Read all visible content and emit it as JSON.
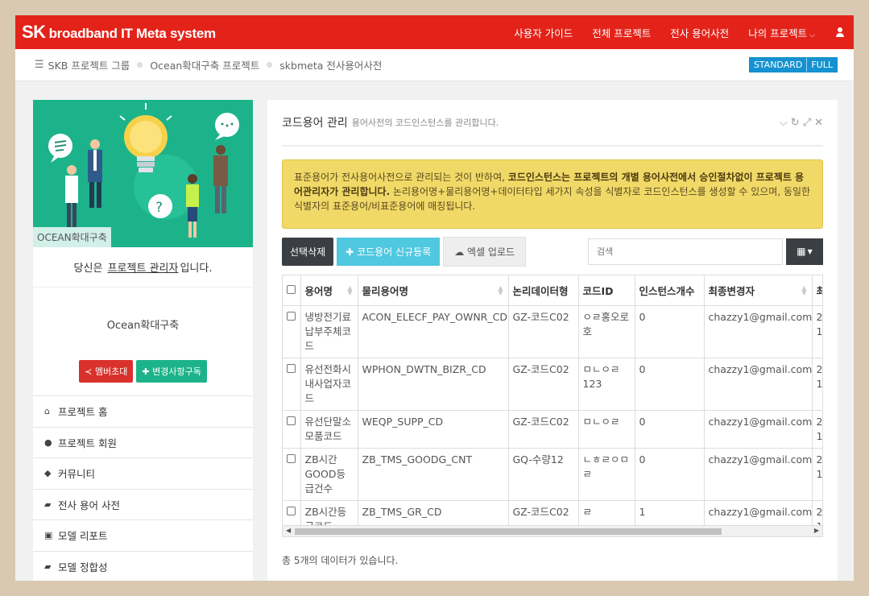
{
  "header": {
    "brand_sk": "SK",
    "brand_rest": "broadband IT Meta system",
    "nav": [
      "사용자 가이드",
      "전체 프로젝트",
      "전사 용어사전",
      "나의 프로젝트"
    ]
  },
  "breadcrumb": {
    "items": [
      "SKB 프로젝트 그룹",
      "Ocean확대구축 프로젝트",
      "skbmeta 전사용어사전"
    ],
    "modes": [
      "STANDARD",
      "FULL"
    ]
  },
  "sidebar": {
    "hero_label": "OCEAN확대구축",
    "role_prefix": "당신은",
    "role_link": "프로젝트 관리자",
    "role_suffix": "입니다.",
    "project_name": "Ocean확대구축",
    "invite_label": "멤버초대",
    "subscribe_label": "변경사항구독",
    "menu": [
      {
        "icon": "home-icon",
        "label": "프로젝트 홈"
      },
      {
        "icon": "users-icon",
        "label": "프로젝트 회원"
      },
      {
        "icon": "comments-icon",
        "label": "커뮤니티"
      },
      {
        "icon": "book-icon",
        "label": "전사 용어 사전"
      },
      {
        "icon": "archive-icon",
        "label": "모델 리포트"
      },
      {
        "icon": "book-icon",
        "label": "모델 정합성"
      }
    ]
  },
  "panel": {
    "title": "코드용어 관리",
    "subtitle": "용어사전의 코드인스턴스를 관리합니다.",
    "alert_1": "표준용어가 전사용어사전으로 관리되는 것이 반하여, ",
    "alert_bold": "코드인스턴스는 프로젝트의 개별 용어사전에서 승인절차없이 프로젝트 용어관리자가 관리합니다.",
    "alert_2": " 논리용어명+물리용어명+데이터타입 세가지 속성을 식별자로 코드인스턴스를 생성할 수 있으며, 동일한 식별자의 표준용어/비표준용어에 매칭됩니다.",
    "btn_delete": "선택삭제",
    "btn_new": "코드용어 신규등록",
    "btn_excel": "엑셀 업로드",
    "search_placeholder": "검색",
    "columns": [
      "용어명",
      "물리용어명",
      "논리데이터형",
      "코드ID",
      "인스턴스개수",
      "최종변경자",
      "최"
    ],
    "rows": [
      {
        "term": "냉방전기료납부주체코드",
        "physical": "ACON_ELECF_PAY_OWNR_CD",
        "logical": "GZ-코드C02",
        "code_id": "ㅇㄹ홍오로호",
        "count": "0",
        "editor": "chazzy1@gmail.com",
        "date": "2(\n1:"
      },
      {
        "term": "유선전화시내사업자코드",
        "physical": "WPHON_DWTN_BIZR_CD",
        "logical": "GZ-코드C02",
        "code_id": "ㅁㄴㅇㄹ123",
        "count": "0",
        "editor": "chazzy1@gmail.com",
        "date": "2(\n1:"
      },
      {
        "term": "유선단말소모품코드",
        "physical": "WEQP_SUPP_CD",
        "logical": "GZ-코드C02",
        "code_id": "ㅁㄴㅇㄹ",
        "count": "0",
        "editor": "chazzy1@gmail.com",
        "date": "2(\n1:"
      },
      {
        "term": "ZB시간GOOD등급건수",
        "physical": "ZB_TMS_GOODG_CNT",
        "logical": "GQ-수량12",
        "code_id": "ㄴㅎㄹㅇㅁㄹ",
        "count": "0",
        "editor": "chazzy1@gmail.com",
        "date": "2(\n1:"
      },
      {
        "term": "ZB시간등급코드",
        "physical": "ZB_TMS_GR_CD",
        "logical": "GZ-코드C02",
        "code_id": "ㄹ",
        "count": "1",
        "editor": "chazzy1@gmail.com",
        "date": "2(\n1("
      }
    ],
    "footer": "총 5개의 데이터가 있습니다."
  },
  "colors": {
    "brand_red": "#e3231a",
    "teal": "#1cb38a",
    "alert": "#f1d968",
    "cyan": "#4fc8e0"
  }
}
